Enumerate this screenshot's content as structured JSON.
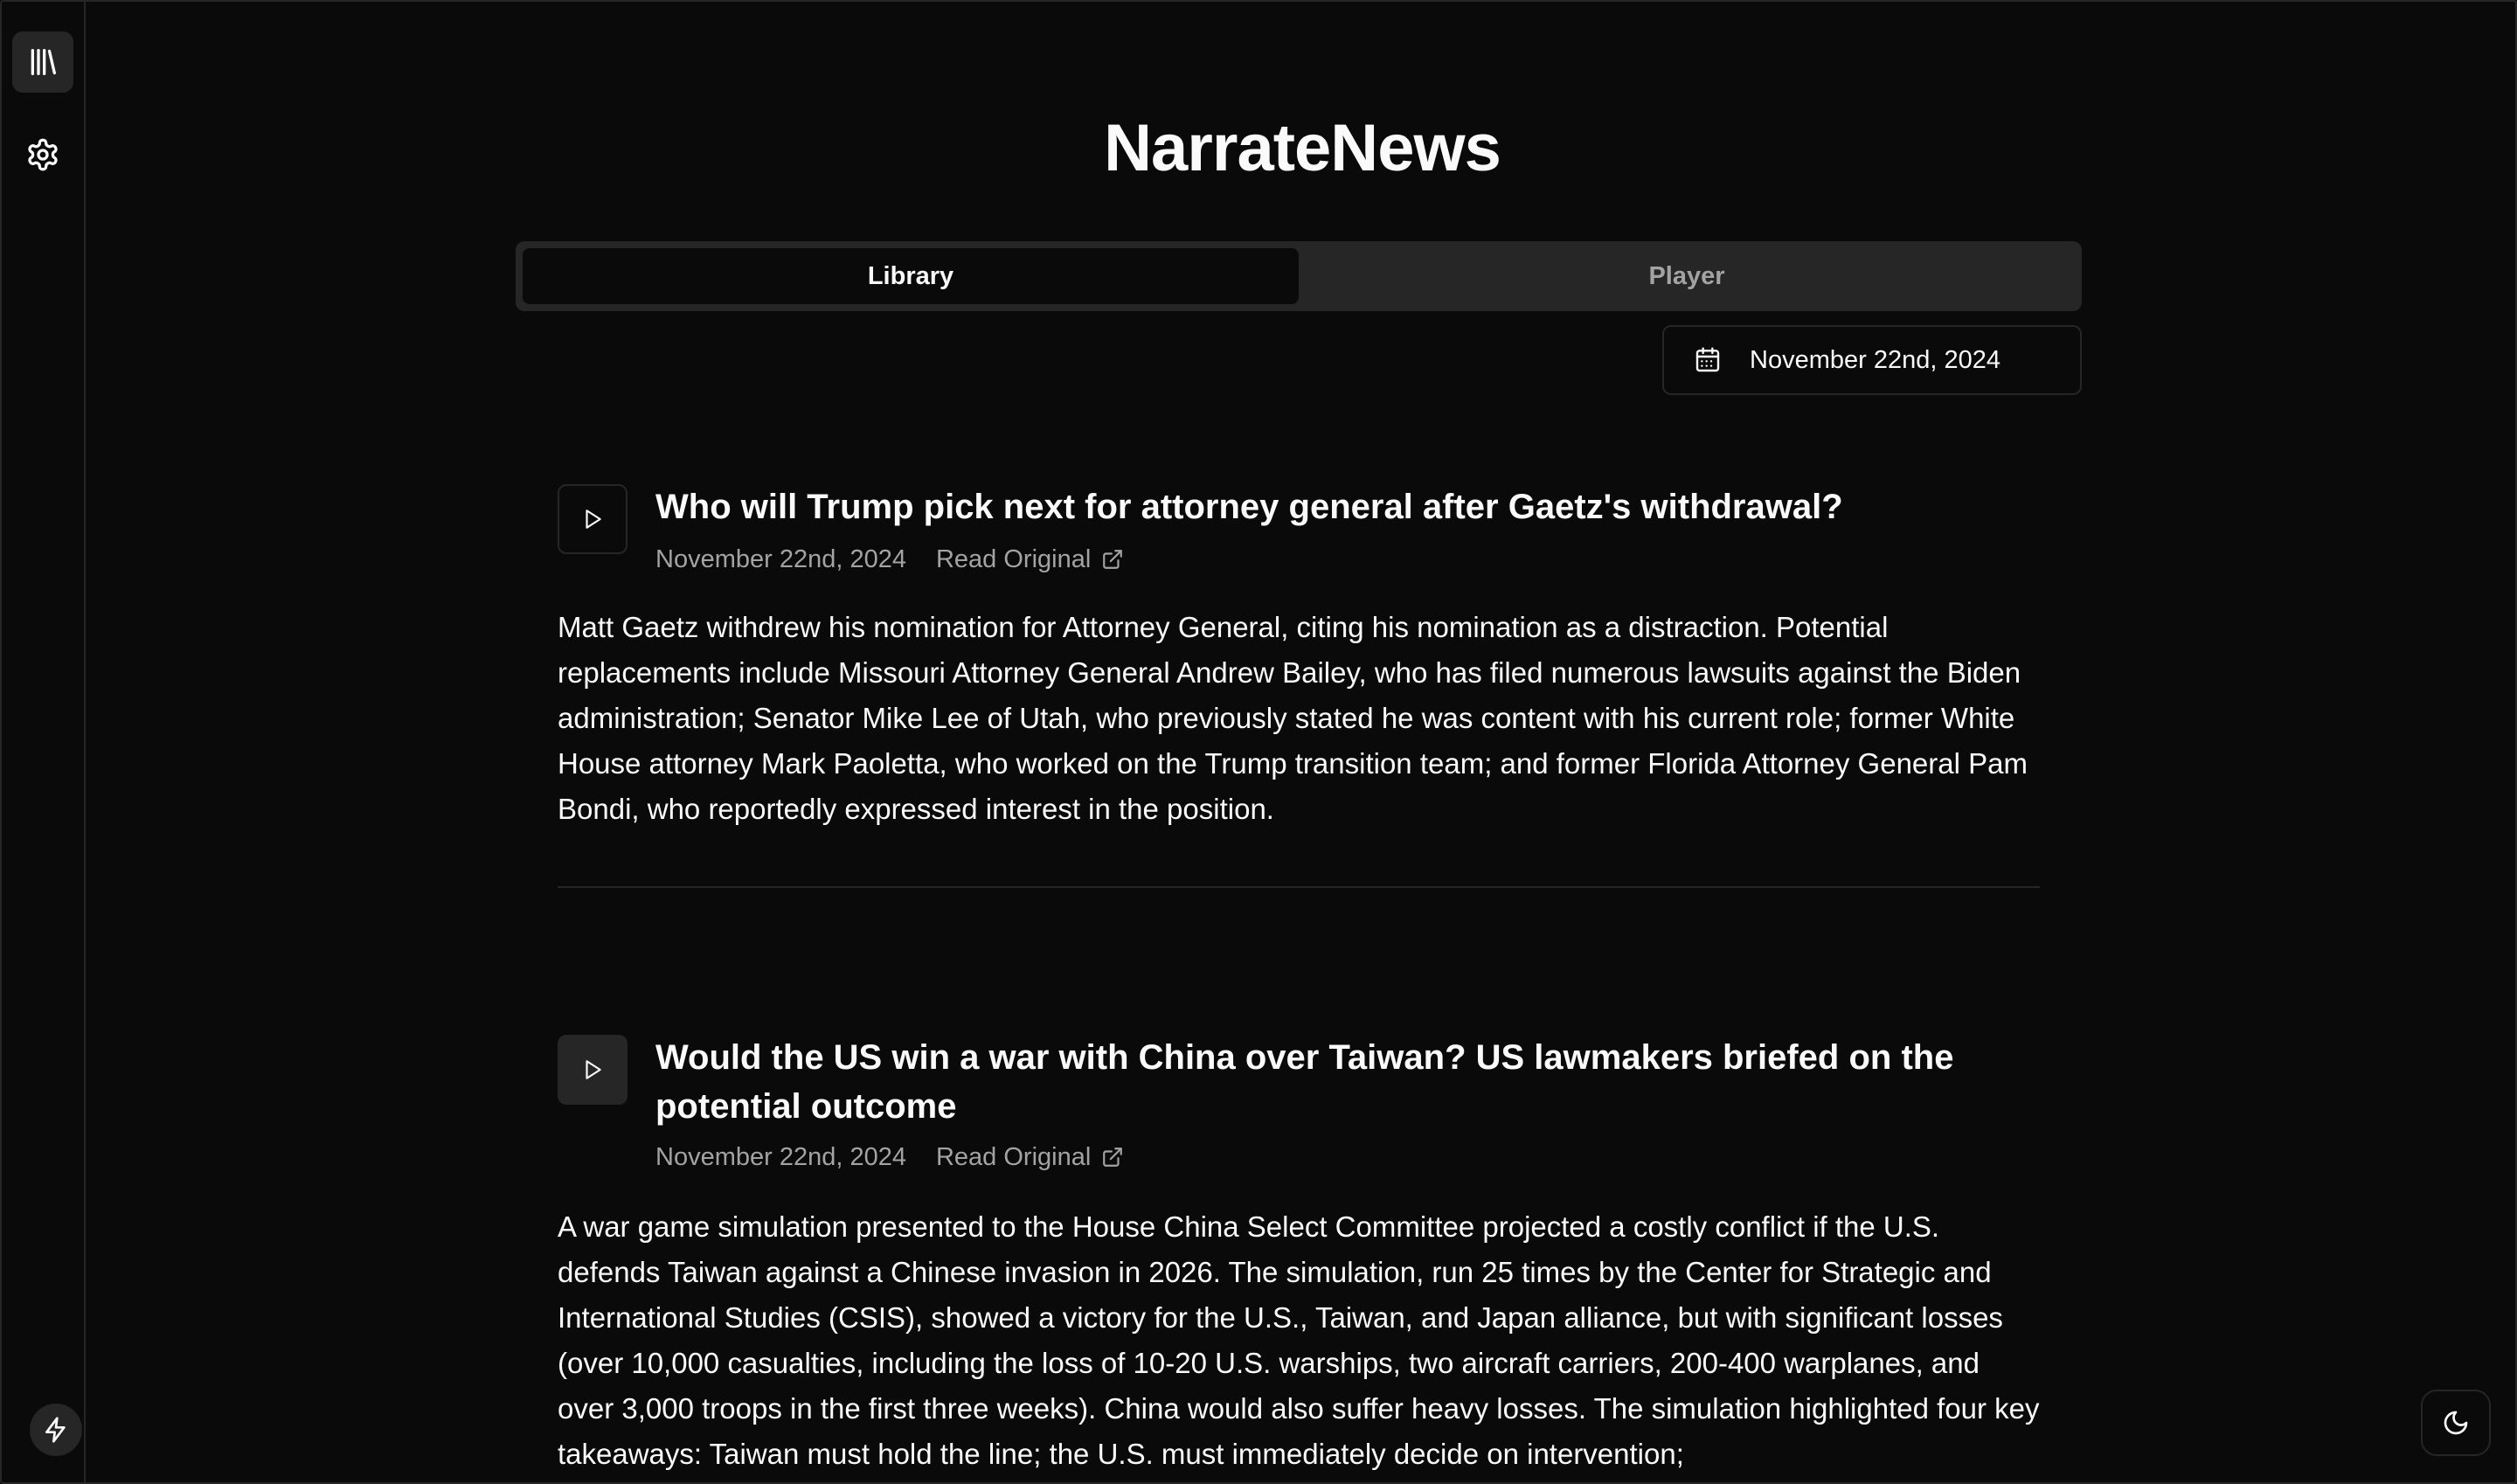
{
  "app": {
    "title": "NarrateNews"
  },
  "sidebar": {
    "items": [
      {
        "icon": "library-icon",
        "active": true
      },
      {
        "icon": "gear-icon",
        "active": false
      }
    ],
    "bottom_icon": "bolt-icon"
  },
  "tabs": [
    {
      "label": "Library",
      "active": true
    },
    {
      "label": "Player",
      "active": false
    }
  ],
  "date_picker": {
    "icon": "calendar-icon",
    "value": "November 22nd, 2024"
  },
  "articles": [
    {
      "title": "Who will Trump pick next for attorney general after Gaetz's withdrawal?",
      "date": "November 22nd, 2024",
      "read_label": "Read Original",
      "summary": "Matt Gaetz withdrew his nomination for Attorney General, citing his nomination as a distraction. Potential replacements include Missouri Attorney General Andrew Bailey, who has filed numerous lawsuits against the Biden administration; Senator Mike Lee of Utah, who previously stated he was content with his current role; former White House attorney Mark Paoletta, who worked on the Trump transition team; and former Florida Attorney General Pam Bondi, who reportedly expressed interest in the position."
    },
    {
      "title": "Would the US win a war with China over Taiwan? US lawmakers briefed on the potential outcome",
      "date": "November 22nd, 2024",
      "read_label": "Read Original",
      "summary": "A war game simulation presented to the House China Select Committee projected a costly conflict if the U.S. defends Taiwan against a Chinese invasion in 2026. The simulation, run 25 times by the Center for Strategic and International Studies (CSIS), showed a victory for the U.S., Taiwan, and Japan alliance, but with significant losses (over 10,000 casualties, including the loss of 10-20 U.S. warships, two aircraft carriers, 200-400 warplanes, and over 3,000 troops in the first three weeks). China would also suffer heavy losses. The simulation highlighted four key takeaways: Taiwan must hold the line; the U.S. must immediately decide on intervention;"
    }
  ],
  "theme_toggle": {
    "icon": "moon-icon"
  }
}
